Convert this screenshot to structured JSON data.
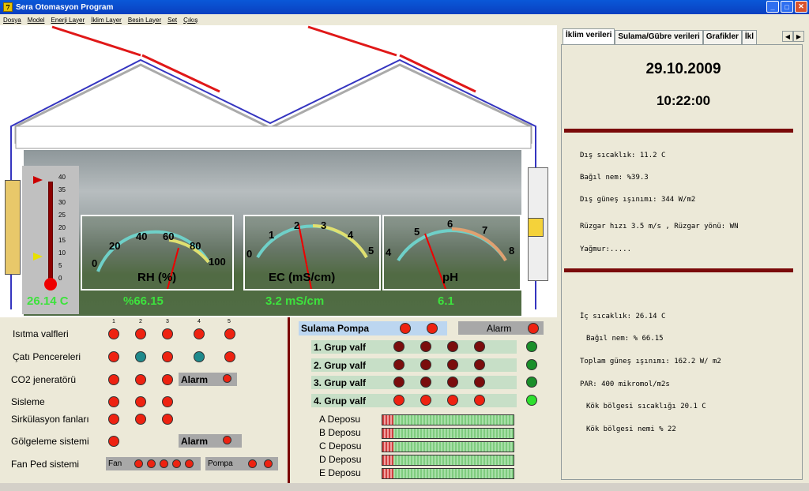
{
  "window": {
    "title": "Sera Otomasyon Program",
    "icon_text": "7"
  },
  "menu": [
    "Dosya",
    "Model",
    "Enerji Layer",
    "İklim Layer",
    "Besin Layer",
    "Set",
    "Çıkış"
  ],
  "thermometer": {
    "ticks": [
      "40",
      "35",
      "30",
      "25",
      "20",
      "15",
      "10",
      "5",
      "0"
    ],
    "value_label": "26.14 C"
  },
  "gauges": [
    {
      "caption": "RH (%)",
      "labels": [
        "0",
        "20",
        "40",
        "60",
        "80",
        "100"
      ],
      "readout": "%66.15"
    },
    {
      "caption": "EC (mS/cm)",
      "labels": [
        "0",
        "1",
        "2",
        "3",
        "4",
        "5"
      ],
      "readout": "3.2 mS/cm"
    },
    {
      "caption": "pH",
      "labels": [
        "4",
        "5",
        "6",
        "7",
        "8"
      ],
      "readout": "6.1"
    }
  ],
  "left": {
    "columns": [
      "1",
      "2",
      "3",
      "4",
      "5"
    ],
    "rows": [
      "Isıtma valfleri",
      "Çatı Pencereleri",
      "CO2 jeneratörü",
      "Sisleme",
      "Sirkülasyon fanları",
      "Gölgeleme sistemi",
      "Fan Ped sistemi"
    ],
    "alarm": "Alarm",
    "fan": "Fan",
    "pompa": "Pompa"
  },
  "mid": {
    "pump": "Sulama Pompa",
    "alarm": "Alarm",
    "groups": [
      "1. Grup valf",
      "2. Grup valf",
      "3. Grup valf",
      "4. Grup valf"
    ],
    "tanks": [
      "A Deposu",
      "B Deposu",
      "C Deposu",
      "D Deposu",
      "E Deposu"
    ]
  },
  "right": {
    "tabs": [
      "İklim verileri",
      "Sulama/Gübre verileri",
      "Grafikler",
      "İkl"
    ],
    "date": "29.10.2009",
    "time": "10:22:00",
    "outside": [
      "Dış sıcaklık: 11.2 C",
      "Bağıl nem: %39.3",
      "Dış güneş ışınımı: 344 W/m2",
      "Rüzgar hızı 3.5 m/s , Rüzgar yönü: WN",
      "Yağmur:....."
    ],
    "inside": [
      "İç sıcaklık: 26.14 C",
      "Bağıl nem: % 66.15",
      "Toplam güneş ışınımı: 162.2 W/ m2",
      "PAR: 400 mikromol/m2s",
      "Kök bölgesi sıcaklığı 20.1 C",
      "Kök bölgesi nemi % 22"
    ]
  }
}
